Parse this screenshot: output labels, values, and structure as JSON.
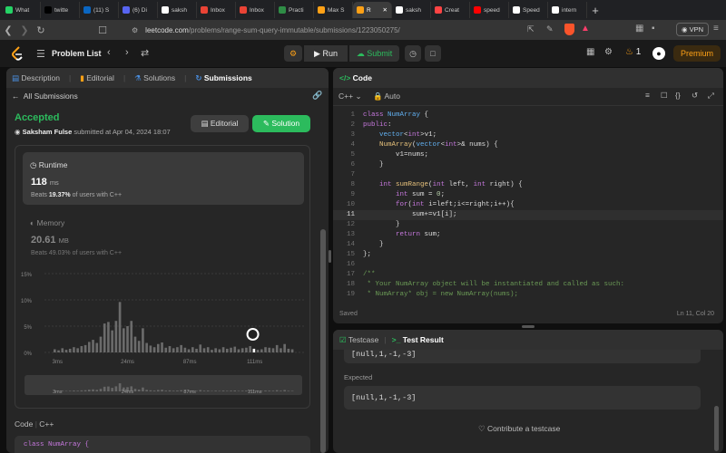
{
  "browser": {
    "tabs": [
      {
        "label": "What",
        "color": "#25d366"
      },
      {
        "label": "twitte",
        "color": "#000000"
      },
      {
        "label": "(11) S",
        "color": "#0a66c2"
      },
      {
        "label": "(6) Di",
        "color": "#5865f2"
      },
      {
        "label": "saksh",
        "color": "#ffffff"
      },
      {
        "label": "Inbox",
        "color": "#ea4335"
      },
      {
        "label": "Inbox",
        "color": "#ea4335"
      },
      {
        "label": "Practi",
        "color": "#2f8d46"
      },
      {
        "label": "Max S",
        "color": "#ffa116"
      },
      {
        "label": "R",
        "color": "#ffa116"
      },
      {
        "label": "saksh",
        "color": "#ffffff"
      },
      {
        "label": "Creat",
        "color": "#ff4444"
      },
      {
        "label": "speed",
        "color": "#ff0000"
      },
      {
        "label": "Speed",
        "color": "#ffffff"
      },
      {
        "label": "intern",
        "color": "#ffffff"
      }
    ],
    "url_host": "leetcode.com",
    "url_path": "/problems/range-sum-query-immutable/submissions/1223050275/",
    "vpn_label": "VPN"
  },
  "leetcode": {
    "problem_list": "Problem List",
    "run": "Run",
    "submit": "Submit",
    "streak": "1",
    "premium": "Premium"
  },
  "left_panel": {
    "tabs": [
      "Description",
      "Editorial",
      "Solutions",
      "Submissions"
    ],
    "all_submissions": "All Submissions",
    "status": "Accepted",
    "user": "Saksham Fulse",
    "submitted_at": "submitted at Apr 04, 2024 18:07",
    "editorial_btn": "Editorial",
    "solution_btn": "Solution",
    "runtime": {
      "label": "Runtime",
      "value": "118",
      "unit": "ms",
      "beats_prefix": "Beats",
      "beats_pct": "19.37%",
      "beats_suffix": "of users with C++"
    },
    "memory": {
      "label": "Memory",
      "value": "20.61",
      "unit": "MB",
      "beats_prefix": "Beats",
      "beats_pct": "49.03%",
      "beats_suffix": "of users with C++"
    },
    "code_label": "Code",
    "lang_label": "C++",
    "code_preview": "class NumArray {"
  },
  "chart_data": {
    "type": "bar",
    "ylabel_ticks": [
      "15%",
      "10%",
      "5%",
      "0%"
    ],
    "x_ticks": [
      "3ms",
      "24ms",
      "87ms",
      "111ms"
    ],
    "ylim": [
      0,
      15
    ],
    "values": [
      0.6,
      0.4,
      0.8,
      0.5,
      0.7,
      1.0,
      0.8,
      1.2,
      1.4,
      2.0,
      2.4,
      1.8,
      3.0,
      5.5,
      5.8,
      4.2,
      6.0,
      9.6,
      4.6,
      5.0,
      6.0,
      3.0,
      2.2,
      4.6,
      1.8,
      1.3,
      1.0,
      1.6,
      1.9,
      0.9,
      1.2,
      0.8,
      1.0,
      1.4,
      0.9,
      0.6,
      1.0,
      0.7,
      1.5,
      0.8,
      1.0,
      0.5,
      0.8,
      0.6,
      1.0,
      0.7,
      0.9,
      1.1,
      0.6,
      0.8,
      0.9,
      1.2,
      0.7,
      0.5,
      0.6,
      1.0,
      0.9,
      0.8,
      1.4,
      0.8,
      1.6,
      0.7,
      0.6
    ],
    "highlight_index": 52
  },
  "editor": {
    "title": "Code",
    "lang": "C++",
    "mode": "Auto",
    "lines": [
      [
        [
          "kw",
          "class "
        ],
        [
          "ty",
          "NumArray"
        ],
        [
          "p",
          " {"
        ]
      ],
      [
        [
          "kw",
          "public"
        ],
        [
          "p",
          ":"
        ]
      ],
      [
        [
          "p",
          "    "
        ],
        [
          "ty",
          "vector"
        ],
        [
          "p",
          "<"
        ],
        [
          "kw",
          "int"
        ],
        [
          "p",
          ">v1;"
        ]
      ],
      [
        [
          "p",
          "    "
        ],
        [
          "fn",
          "NumArray"
        ],
        [
          "p",
          "("
        ],
        [
          "ty",
          "vector"
        ],
        [
          "p",
          "<"
        ],
        [
          "kw",
          "int"
        ],
        [
          "p",
          ">& nums) {"
        ]
      ],
      [
        [
          "p",
          "        v1=nums;"
        ]
      ],
      [
        [
          "p",
          "    }"
        ]
      ],
      [
        [
          "p",
          ""
        ]
      ],
      [
        [
          "p",
          "    "
        ],
        [
          "kw",
          "int "
        ],
        [
          "fn",
          "sumRange"
        ],
        [
          "p",
          "("
        ],
        [
          "kw",
          "int"
        ],
        [
          "p",
          " left, "
        ],
        [
          "kw",
          "int"
        ],
        [
          "p",
          " right) {"
        ]
      ],
      [
        [
          "p",
          "        "
        ],
        [
          "kw",
          "int"
        ],
        [
          "p",
          " sum = "
        ],
        [
          "nm",
          "0"
        ],
        [
          "p",
          ";"
        ]
      ],
      [
        [
          "p",
          "        "
        ],
        [
          "kw",
          "for"
        ],
        [
          "p",
          "("
        ],
        [
          "kw",
          "int"
        ],
        [
          "p",
          " i=left;i<=right;i++){"
        ]
      ],
      [
        [
          "p",
          "            sum+=v1[i];"
        ]
      ],
      [
        [
          "p",
          "        }"
        ]
      ],
      [
        [
          "p",
          "        "
        ],
        [
          "kw",
          "return"
        ],
        [
          "p",
          " sum;"
        ]
      ],
      [
        [
          "p",
          "    }"
        ]
      ],
      [
        [
          "p",
          "};"
        ]
      ],
      [
        [
          "p",
          ""
        ]
      ],
      [
        [
          "cm",
          "/**"
        ]
      ],
      [
        [
          "cm",
          " * Your NumArray object will be instantiated and called as such:"
        ]
      ],
      [
        [
          "cm",
          " * NumArray* obj = new NumArray(nums);"
        ]
      ]
    ],
    "saved": "Saved",
    "cursor": "Ln 11, Col 20"
  },
  "result_panel": {
    "tab_testcase": "Testcase",
    "tab_result": "Test Result",
    "output_value": "[null,1,-1,-3]",
    "expected_label": "Expected",
    "expected_value": "[null,1,-1,-3]",
    "contribute": "Contribute a testcase"
  }
}
